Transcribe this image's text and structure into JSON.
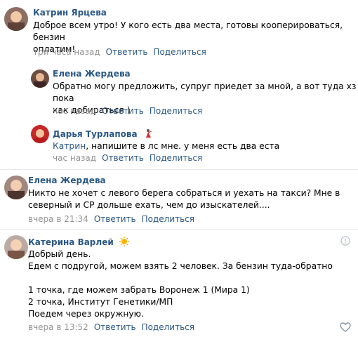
{
  "comments": [
    {
      "author": "Катрин Ярцева",
      "text": [
        "Доброе всем утро! У кого есть два места, готовы кооперироваться, бензин",
        "оплатим!"
      ],
      "time": "три часа назад",
      "reply": "Ответить",
      "share": "Поделиться"
    },
    {
      "author": "Елена Жердева",
      "text": [
        "Обратно могу предложить, супруг приедет за мной, а вот туда хз пока",
        "как добираться )"
      ],
      "time": "час назад",
      "reply": "Ответить",
      "share": "Поделиться"
    },
    {
      "author": "Дарья Турлапова",
      "mention": "Катрин",
      "text_after_mention": ", напишите в лс мне. у меня есть два еста",
      "time": "час назад",
      "reply": "Ответить",
      "share": "Поделиться"
    },
    {
      "author": "Елена Жердева",
      "text": [
        "Никто не хочет с левого берега собраться и уехать на такси? Мне в",
        "северный и СР дольше ехать, чем до изыскателей...."
      ],
      "time": "вчера в 21:34",
      "reply": "Ответить",
      "share": "Поделиться"
    },
    {
      "author": "Катерина Варлей",
      "text": [
        "Добрый день.",
        "Едем с подругой, можем взять 2 человек. За бензин туда-обратно",
        "",
        "1 точка, где можем забрать Воронеж 1 (Мира 1)",
        "2 точка, Институт Генетики/МП",
        "Поедем через окружную."
      ],
      "time": "вчера в 13:52",
      "reply": "Ответить",
      "share": "Поделиться"
    }
  ],
  "colors": {
    "link": "#2a5885",
    "meta": "#939393",
    "divider": "#e7e8ec"
  },
  "icons": [
    "info-icon",
    "like-heart-icon",
    "emoji-icon",
    "dancer-emoji-icon"
  ]
}
